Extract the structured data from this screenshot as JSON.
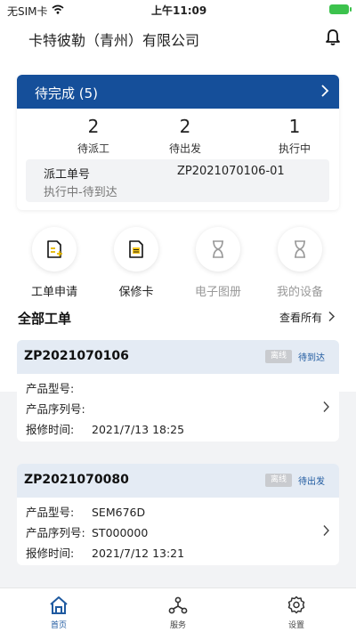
{
  "status_bar": {
    "carrier": "无SIM卡",
    "time": "上午11:09"
  },
  "header": {
    "company": "卡特彼勒（青州）有限公司"
  },
  "pending": {
    "title": "待完成 (5)",
    "stats": [
      {
        "value": "2",
        "label": "待派工"
      },
      {
        "value": "2",
        "label": "待出发"
      },
      {
        "value": "1",
        "label": "执行中"
      }
    ],
    "order": {
      "key": "派工单号",
      "value": "ZP2021070106-01",
      "status": "执行中-待到达"
    }
  },
  "quick_actions": [
    {
      "label": "工单申请",
      "icon": "document-add-icon",
      "enabled": true
    },
    {
      "label": "保修卡",
      "icon": "document-icon",
      "enabled": true
    },
    {
      "label": "电子图册",
      "icon": "hourglass-icon",
      "enabled": false
    },
    {
      "label": "我的设备",
      "icon": "hourglass-icon",
      "enabled": false
    }
  ],
  "work_orders": {
    "title": "全部工单",
    "view_all": "查看所有",
    "items": [
      {
        "code": "ZP2021070106",
        "offline_badge": "离线",
        "status": "待到达",
        "rows": [
          {
            "key": "产品型号:",
            "value": ""
          },
          {
            "key": "产品序列号:",
            "value": ""
          },
          {
            "key": "报修时间:",
            "value": "2021/7/13 18:25"
          }
        ]
      },
      {
        "code": "ZP2021070080",
        "offline_badge": "离线",
        "status": "待出发",
        "rows": [
          {
            "key": "产品型号:",
            "value": "SEM676D"
          },
          {
            "key": "产品序列号:",
            "value": "ST000000"
          },
          {
            "key": "报修时间:",
            "value": "2021/7/12 13:21"
          }
        ]
      }
    ]
  },
  "tabbar": [
    {
      "label": "首页",
      "icon": "home-icon",
      "active": true
    },
    {
      "label": "服务",
      "icon": "service-network-icon",
      "active": false
    },
    {
      "label": "设置",
      "icon": "gear-icon",
      "active": false
    }
  ],
  "colors": {
    "primary": "#154f9a",
    "accent": "#f5c518",
    "card_header": "#e4ebf4"
  }
}
